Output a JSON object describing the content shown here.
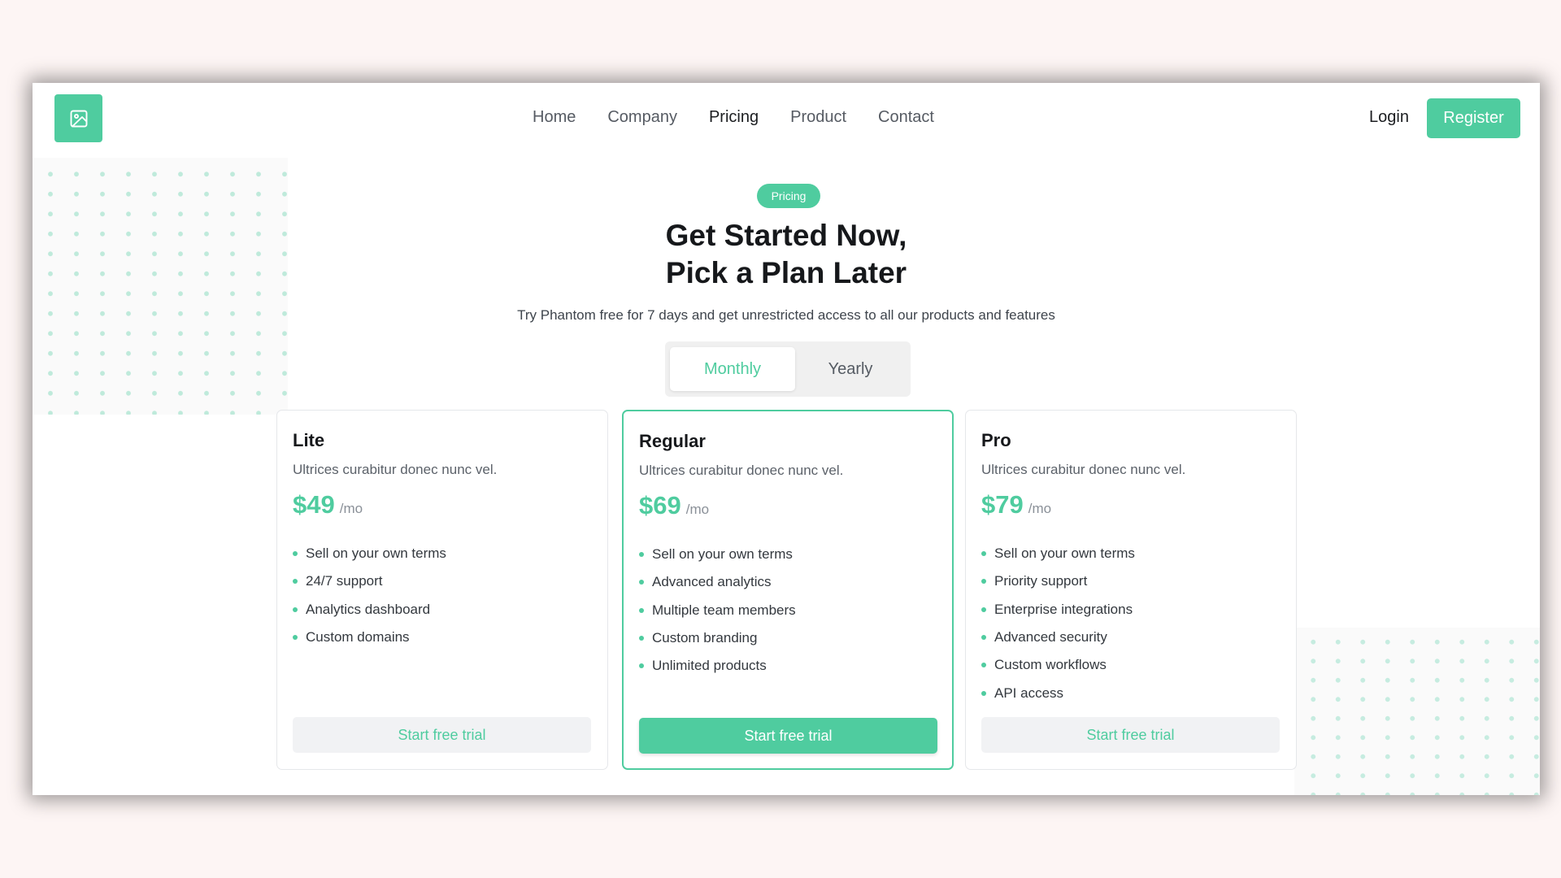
{
  "nav": {
    "logo_icon": "image-icon",
    "links": [
      "Home",
      "Company",
      "Pricing",
      "Product",
      "Contact"
    ],
    "active": "Pricing",
    "login_label": "Login",
    "register_label": "Register"
  },
  "hero": {
    "badge": "Pricing",
    "title_line1": "Get Started Now,",
    "title_line2": "Pick a Plan Later",
    "subtitle": "Try Phantom free for 7 days and get unrestricted access to all our products and features"
  },
  "billing_toggle": {
    "options": [
      "Monthly",
      "Yearly"
    ],
    "selected": "Monthly"
  },
  "plans": [
    {
      "name": "Lite",
      "description": "Ultrices curabitur donec nunc vel.",
      "price": "$49",
      "period": "/mo",
      "features": [
        "Sell on your own terms",
        "24/7 support",
        "Analytics dashboard",
        "Custom domains"
      ],
      "cta": "Start free trial",
      "featured": false
    },
    {
      "name": "Regular",
      "description": "Ultrices curabitur donec nunc vel.",
      "price": "$69",
      "period": "/mo",
      "features": [
        "Sell on your own terms",
        "Advanced analytics",
        "Multiple team members",
        "Custom branding",
        "Unlimited products"
      ],
      "cta": "Start free trial",
      "featured": true
    },
    {
      "name": "Pro",
      "description": "Ultrices curabitur donec nunc vel.",
      "price": "$79",
      "period": "/mo",
      "features": [
        "Sell on your own terms",
        "Priority support",
        "Enterprise integrations",
        "Advanced security",
        "Custom workflows",
        "API access"
      ],
      "cta": "Start free trial",
      "featured": false
    }
  ],
  "colors": {
    "accent": "#4fcc9f",
    "page_background": "#fdf5f4",
    "text_dark": "#16181b",
    "text_muted": "#5c626a"
  }
}
